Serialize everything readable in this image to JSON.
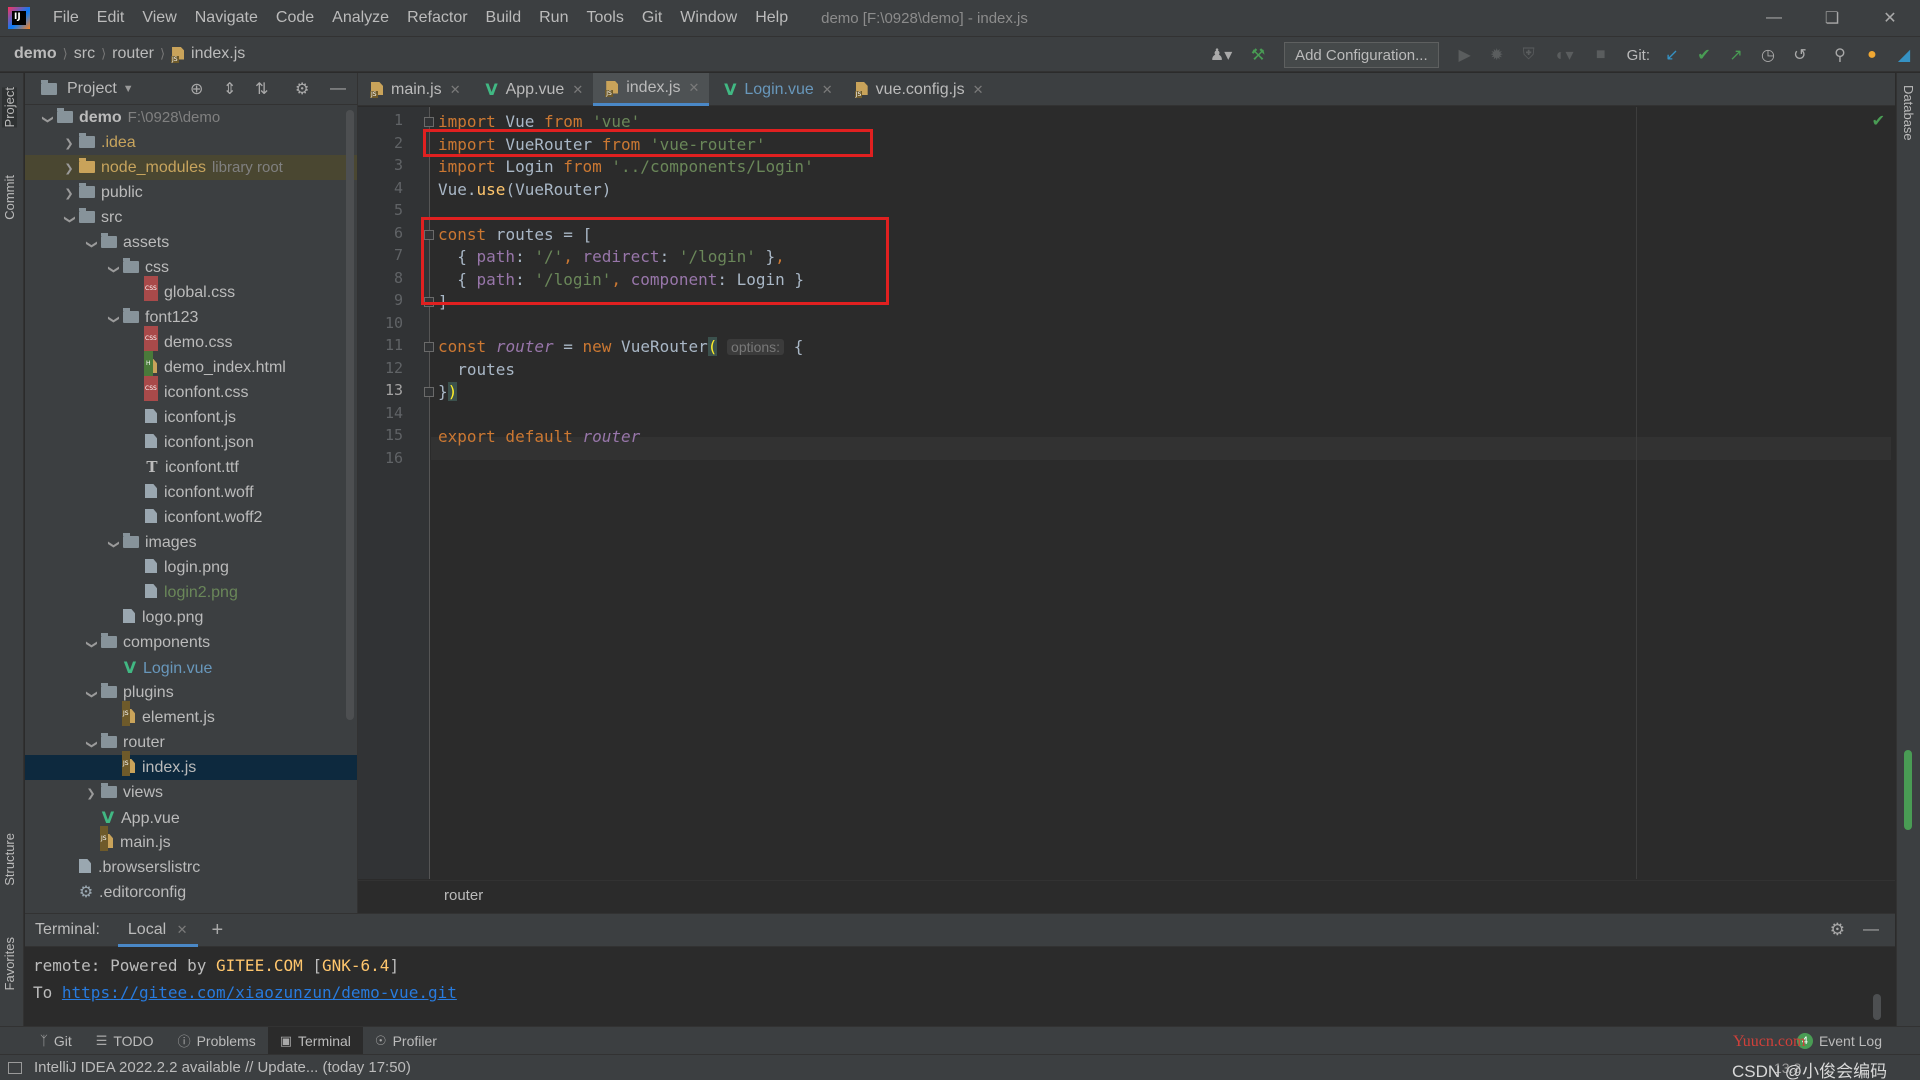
{
  "app": {
    "logo_text": "IJ",
    "window_title": "demo [F:\\0928\\demo] - index.js"
  },
  "menu": [
    "File",
    "Edit",
    "View",
    "Navigate",
    "Code",
    "Analyze",
    "Refactor",
    "Build",
    "Run",
    "Tools",
    "Git",
    "Window",
    "Help"
  ],
  "navbar": {
    "crumbs": [
      "demo",
      "src",
      "router",
      "index.js"
    ],
    "add_configuration": "Add Configuration...",
    "git_label": "Git:"
  },
  "left_strip": {
    "project": "Project",
    "commit": "Commit",
    "structure": "Structure",
    "favorites": "Favorites"
  },
  "right_strip": {
    "database": "Database"
  },
  "project_panel": {
    "title": "Project",
    "tree": [
      {
        "label": "demo",
        "extra": "F:\\0928\\demo",
        "depth": 0,
        "arrow": "open",
        "icon": "folder"
      },
      {
        "label": ".idea",
        "depth": 1,
        "arrow": "closed",
        "icon": "folder",
        "color": "orange"
      },
      {
        "label": "node_modules",
        "extra": "library root",
        "depth": 1,
        "arrow": "closed",
        "icon": "folder-orange",
        "color": "orange",
        "excluded": true
      },
      {
        "label": "public",
        "depth": 1,
        "arrow": "closed",
        "icon": "folder"
      },
      {
        "label": "src",
        "depth": 1,
        "arrow": "open",
        "icon": "folder"
      },
      {
        "label": "assets",
        "depth": 2,
        "arrow": "open",
        "icon": "folder"
      },
      {
        "label": "css",
        "depth": 3,
        "arrow": "open",
        "icon": "folder"
      },
      {
        "label": "global.css",
        "depth": 4,
        "icon": "css"
      },
      {
        "label": "font123",
        "depth": 3,
        "arrow": "open",
        "icon": "folder"
      },
      {
        "label": "demo.css",
        "depth": 4,
        "icon": "css"
      },
      {
        "label": "demo_index.html",
        "depth": 4,
        "icon": "html"
      },
      {
        "label": "iconfont.css",
        "depth": 4,
        "icon": "css"
      },
      {
        "label": "iconfont.js",
        "depth": 4,
        "icon": "file"
      },
      {
        "label": "iconfont.json",
        "depth": 4,
        "icon": "file"
      },
      {
        "label": "iconfont.ttf",
        "depth": 4,
        "icon": "font"
      },
      {
        "label": "iconfont.woff",
        "depth": 4,
        "icon": "file"
      },
      {
        "label": "iconfont.woff2",
        "depth": 4,
        "icon": "file"
      },
      {
        "label": "images",
        "depth": 3,
        "arrow": "open",
        "icon": "folder"
      },
      {
        "label": "login.png",
        "depth": 4,
        "icon": "file"
      },
      {
        "label": "login2.png",
        "depth": 4,
        "icon": "file",
        "color": "green"
      },
      {
        "label": "logo.png",
        "depth": 3,
        "icon": "file"
      },
      {
        "label": "components",
        "depth": 2,
        "arrow": "open",
        "icon": "folder"
      },
      {
        "label": "Login.vue",
        "depth": 3,
        "icon": "vue",
        "color": "blue"
      },
      {
        "label": "plugins",
        "depth": 2,
        "arrow": "open",
        "icon": "folder"
      },
      {
        "label": "element.js",
        "depth": 3,
        "icon": "js"
      },
      {
        "label": "router",
        "depth": 2,
        "arrow": "open",
        "icon": "folder"
      },
      {
        "label": "index.js",
        "depth": 3,
        "icon": "js",
        "selected": true
      },
      {
        "label": "views",
        "depth": 2,
        "arrow": "closed",
        "icon": "folder"
      },
      {
        "label": "App.vue",
        "depth": 2,
        "icon": "vue"
      },
      {
        "label": "main.js",
        "depth": 2,
        "icon": "js"
      },
      {
        "label": ".browserslistrc",
        "depth": 1,
        "icon": "file"
      },
      {
        "label": ".editorconfig",
        "depth": 1,
        "icon": "gear"
      }
    ]
  },
  "tabs": [
    {
      "label": "main.js",
      "icon": "js"
    },
    {
      "label": "App.vue",
      "icon": "vue"
    },
    {
      "label": "index.js",
      "icon": "js",
      "active": true
    },
    {
      "label": "Login.vue",
      "icon": "vue",
      "color": "blue"
    },
    {
      "label": "vue.config.js",
      "icon": "js"
    }
  ],
  "editor": {
    "current_line": 13,
    "lines": [
      [
        [
          "kw",
          "import"
        ],
        [
          "t",
          " Vue "
        ],
        [
          "kw",
          "from"
        ],
        [
          "t",
          " "
        ],
        [
          "str",
          "'vue'"
        ]
      ],
      [
        [
          "kw",
          "import"
        ],
        [
          "t",
          " VueRouter "
        ],
        [
          "kw",
          "from"
        ],
        [
          "t",
          " "
        ],
        [
          "str",
          "'vue-router'"
        ]
      ],
      [
        [
          "kw",
          "import"
        ],
        [
          "t",
          " Login "
        ],
        [
          "kw",
          "from"
        ],
        [
          "t",
          " "
        ],
        [
          "str",
          "'../components/Login'"
        ]
      ],
      [
        [
          "t",
          "Vue."
        ],
        [
          "fn",
          "use"
        ],
        [
          "t",
          "(VueRouter)"
        ]
      ],
      [],
      [
        [
          "kw",
          "const"
        ],
        [
          "t",
          " routes = ["
        ]
      ],
      [
        [
          "t",
          "  { "
        ],
        [
          "prop",
          "path"
        ],
        [
          "t",
          ": "
        ],
        [
          "str",
          "'/'"
        ],
        [
          "kw",
          ", "
        ],
        [
          "prop",
          "redirect"
        ],
        [
          "t",
          ": "
        ],
        [
          "str",
          "'/login'"
        ],
        [
          "t",
          " }"
        ],
        [
          "kw",
          ","
        ]
      ],
      [
        [
          "t",
          "  { "
        ],
        [
          "prop",
          "path"
        ],
        [
          "t",
          ": "
        ],
        [
          "str",
          "'/login'"
        ],
        [
          "kw",
          ", "
        ],
        [
          "prop",
          "component"
        ],
        [
          "t",
          ": Login }"
        ]
      ],
      [
        [
          "t",
          "]"
        ]
      ],
      [],
      [
        [
          "kw",
          "const"
        ],
        [
          "t",
          " "
        ],
        [
          "ital",
          "router"
        ],
        [
          "t",
          " = "
        ],
        [
          "kw",
          "new"
        ],
        [
          "t",
          " VueRouter"
        ],
        [
          "brace",
          "("
        ],
        [
          "t",
          " "
        ],
        [
          "hint",
          "options:"
        ],
        [
          "t",
          " {"
        ]
      ],
      [
        [
          "t",
          "  routes"
        ]
      ],
      [
        [
          "t",
          "}"
        ],
        [
          "brace",
          ")"
        ]
      ],
      [],
      [
        [
          "kw",
          "export default"
        ],
        [
          "t",
          " "
        ],
        [
          "ital",
          "router"
        ]
      ],
      []
    ],
    "breadcrumb": "router"
  },
  "terminal": {
    "title": "Terminal:",
    "tab": "Local",
    "line1_prefix": "remote: Powered by ",
    "line1_brand": "GITEE.COM",
    "line1_suffix": " [",
    "line1_version": "GNK-6.4",
    "line1_end": "]",
    "line2_prefix": "To ",
    "line2_link": "https://gitee.com/xiaozunzun/demo-vue.git"
  },
  "bottom_tools": [
    {
      "label": "Git",
      "icon": "git-branch-icon"
    },
    {
      "label": "TODO",
      "icon": "list-icon"
    },
    {
      "label": "Problems",
      "icon": "info-icon"
    },
    {
      "label": "Terminal",
      "icon": "terminal-icon",
      "active": true
    },
    {
      "label": "Profiler",
      "icon": "profiler-icon"
    }
  ],
  "event_log": {
    "count": "4",
    "label": "Event Log"
  },
  "status": {
    "message": "IntelliJ IDEA 2022.2.2 available // Update... (today 17:50)",
    "watermark": "CSDN @小俊会编码",
    "yuucn": "Yuucn.com",
    "position": "13:3"
  },
  "colors": {
    "accent": "#4a88c7",
    "highlight_box": "#e02020",
    "keyword": "#cc7832",
    "string": "#6a8759"
  }
}
